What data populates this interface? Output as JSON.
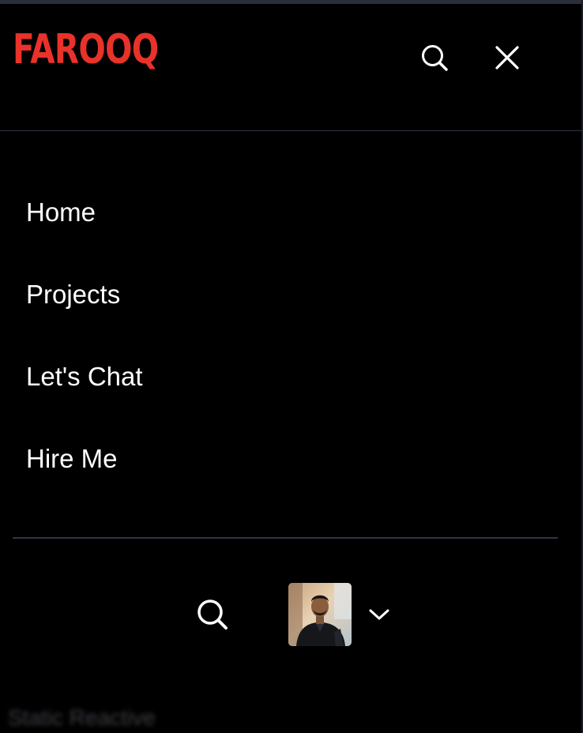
{
  "header": {
    "logo_text": "FAROOQ",
    "search_icon": "search-icon",
    "close_icon": "close-icon"
  },
  "nav": {
    "items": [
      {
        "label": "Home"
      },
      {
        "label": "Projects"
      },
      {
        "label": "Let's Chat"
      },
      {
        "label": "Hire Me"
      }
    ]
  },
  "bottom_bar": {
    "search_icon": "search-icon",
    "avatar_icon": "user-avatar-photo",
    "chevron_icon": "chevron-down-icon"
  },
  "footer": {
    "ghost_text": "Static Reactive"
  },
  "colors": {
    "background": "#000000",
    "brand": "#e8322a",
    "text": "#ffffff",
    "divider": "#2f3542"
  }
}
